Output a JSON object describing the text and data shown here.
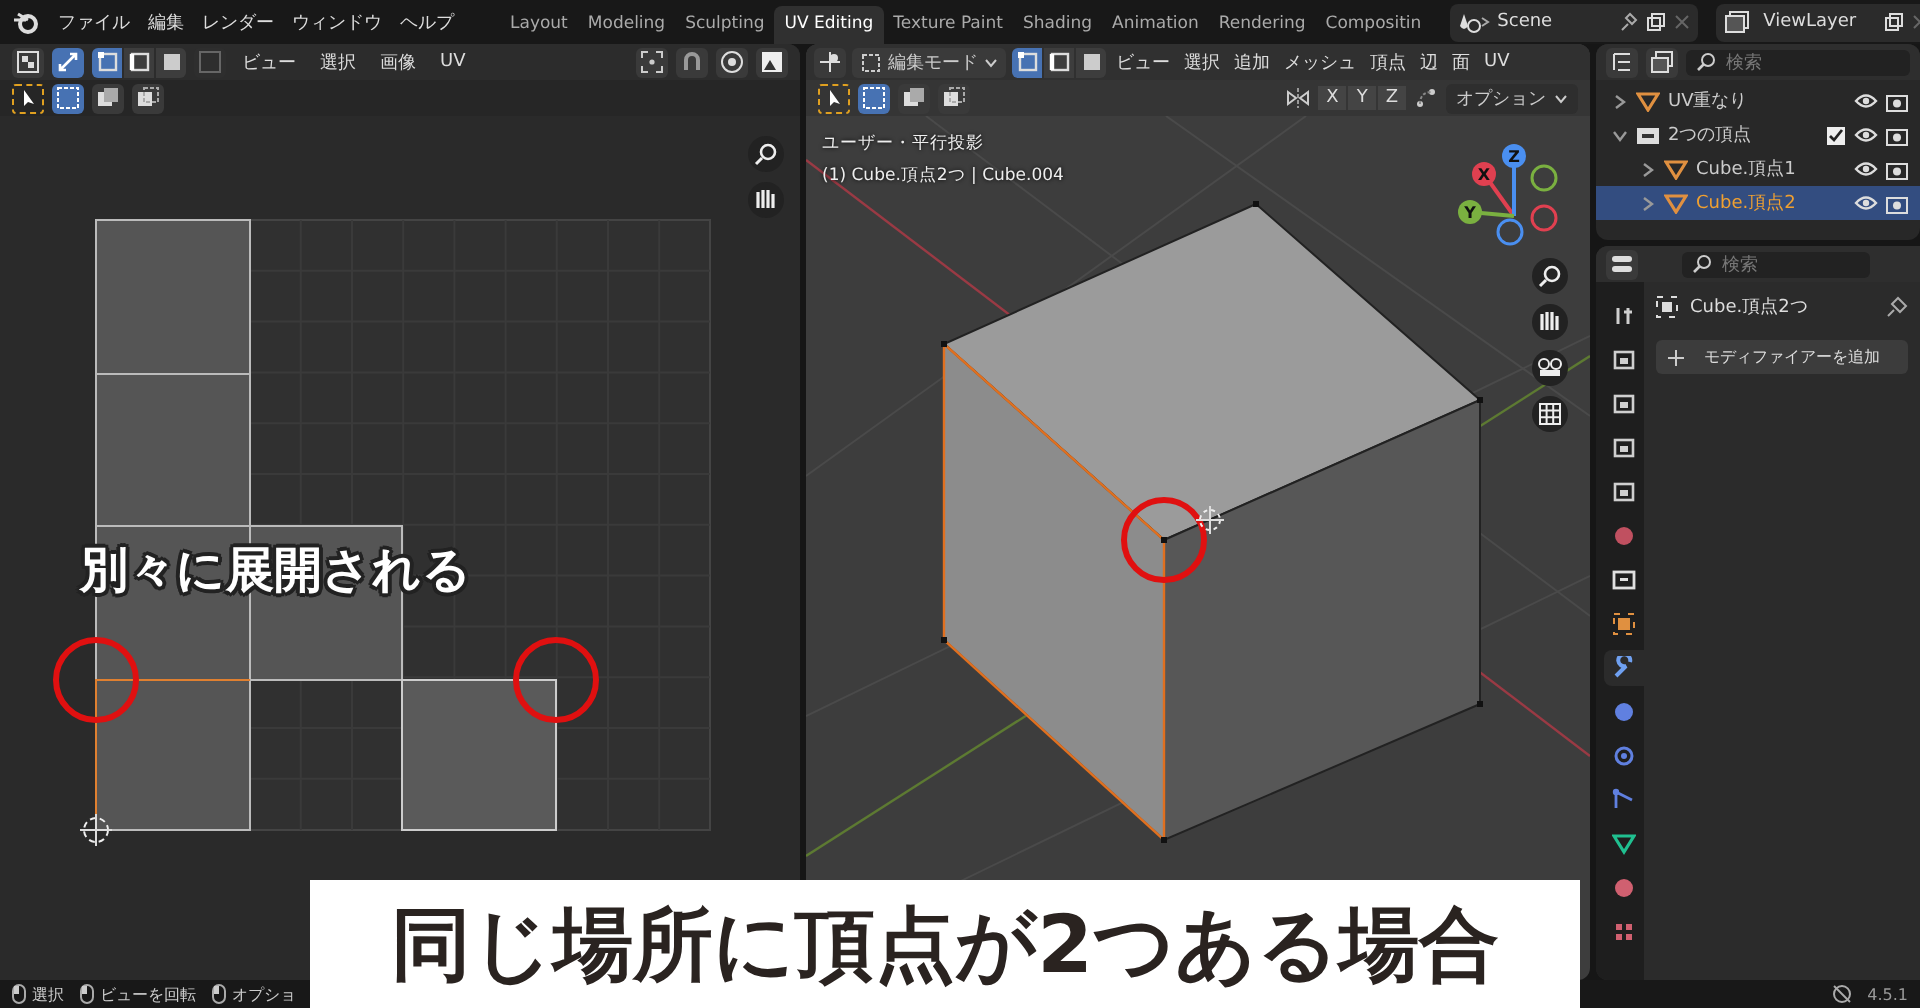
{
  "menu": [
    "ファイル",
    "編集",
    "レンダー",
    "ウィンドウ",
    "ヘルプ"
  ],
  "workspaces": [
    {
      "label": "Layout",
      "selected": false
    },
    {
      "label": "Modeling",
      "selected": false
    },
    {
      "label": "Sculpting",
      "selected": false
    },
    {
      "label": "UV Editing",
      "selected": true
    },
    {
      "label": "Texture Paint",
      "selected": false
    },
    {
      "label": "Shading",
      "selected": false
    },
    {
      "label": "Animation",
      "selected": false
    },
    {
      "label": "Rendering",
      "selected": false
    },
    {
      "label": "Compositin",
      "selected": false
    }
  ],
  "scene": {
    "value": "Scene"
  },
  "view_layer": {
    "value": "ViewLayer"
  },
  "uv_editor": {
    "menus": [
      "ビュー",
      "選択",
      "画像",
      "UV"
    ],
    "sync_selection": true,
    "select_modes": [
      {
        "selected": true
      },
      {
        "selected": false
      },
      {
        "selected": false
      }
    ],
    "caption": "別々に展開される"
  },
  "viewport": {
    "mode": "編集モード",
    "menus": [
      "ビュー",
      "選択",
      "追加",
      "メッシュ",
      "頂点",
      "辺",
      "面",
      "UV"
    ],
    "select_modes": [
      {
        "selected": true
      },
      {
        "selected": false
      },
      {
        "selected": false
      }
    ],
    "axes": [
      "X",
      "Y",
      "Z"
    ],
    "options": "オプション",
    "view_name": "ユーザー・平行投影",
    "object_info": "(1) Cube.頂点2つ | Cube.004",
    "gizmo": [
      "X",
      "Y",
      "Z"
    ]
  },
  "outliner": {
    "search": {
      "placeholder": "検索"
    },
    "items": [
      {
        "label": "UV重なり",
        "expanded": false,
        "selected": false
      },
      {
        "label": "2つの頂点",
        "expanded": true,
        "selected": false,
        "children": [
          {
            "label": "Cube.頂点1",
            "expanded": false,
            "selected": false
          },
          {
            "label": "Cube.頂点2",
            "expanded": false,
            "selected": true
          }
        ]
      }
    ]
  },
  "properties": {
    "search": {
      "placeholder": "検索"
    },
    "object_name": "Cube.頂点2つ",
    "add_modifier": "モディファイアーを追加",
    "tabs": [
      {
        "kind": "tool",
        "selected": false
      },
      {
        "kind": "render",
        "selected": false
      },
      {
        "kind": "output",
        "selected": false
      },
      {
        "kind": "view-layer",
        "selected": false
      },
      {
        "kind": "scene",
        "selected": false
      },
      {
        "kind": "world",
        "selected": false
      },
      {
        "kind": "collection",
        "selected": false
      },
      {
        "kind": "object",
        "selected": false
      },
      {
        "kind": "modifier",
        "selected": true
      },
      {
        "kind": "particles",
        "selected": false
      },
      {
        "kind": "physics",
        "selected": false
      },
      {
        "kind": "constraints",
        "selected": false
      },
      {
        "kind": "data",
        "selected": false
      },
      {
        "kind": "material",
        "selected": false
      },
      {
        "kind": "texture",
        "selected": false
      }
    ]
  },
  "status_bar": {
    "items": [
      "選択",
      "ビューを回転",
      "オプショ"
    ],
    "version": "4.5.1"
  },
  "banner": "同じ場所に頂点が2つある場合"
}
